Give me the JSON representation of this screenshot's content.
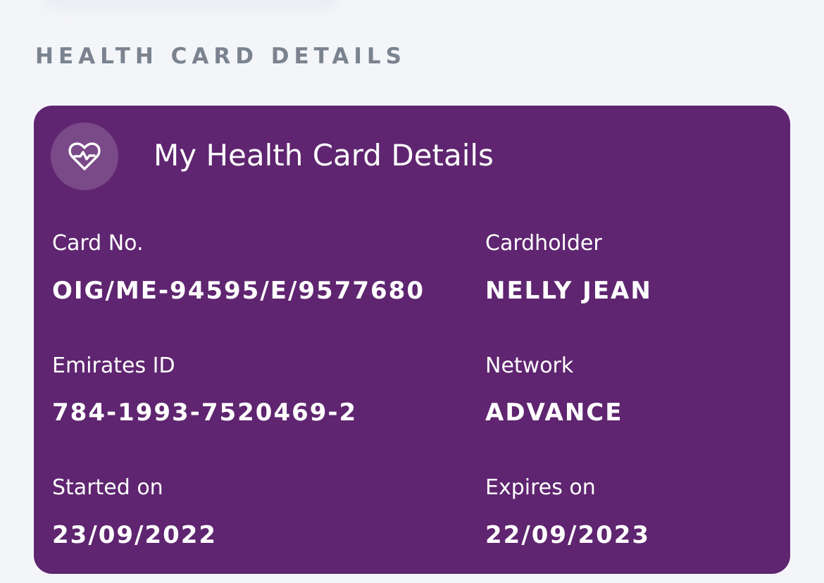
{
  "section_title": "HEALTH CARD DETAILS",
  "card": {
    "title": "My Health Card Details",
    "icon": "heart-pulse-icon",
    "background_color": "#5f2570",
    "fields": {
      "card_no": {
        "label": "Card No.",
        "value": "OIG/ME-94595/E/9577680"
      },
      "cardholder": {
        "label": "Cardholder",
        "value": "NELLY JEAN"
      },
      "emirates_id": {
        "label": "Emirates ID",
        "value": "784-1993-7520469-2"
      },
      "network": {
        "label": "Network",
        "value": "ADVANCE"
      },
      "started_on": {
        "label": "Started on",
        "value": "23/09/2022"
      },
      "expires_on": {
        "label": "Expires on",
        "value": "22/09/2023"
      }
    }
  }
}
